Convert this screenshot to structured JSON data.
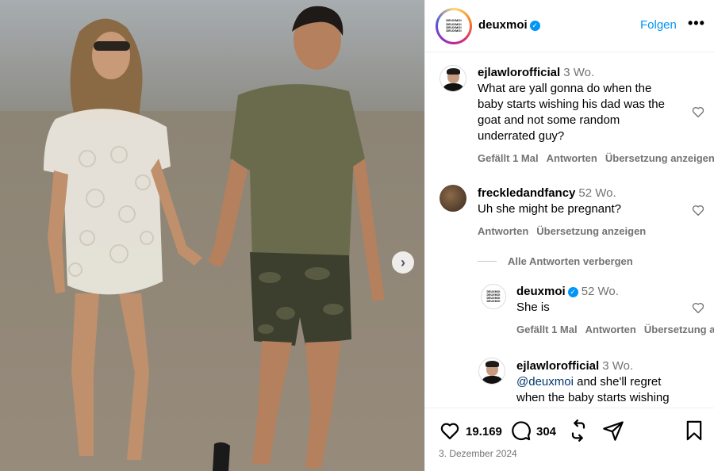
{
  "post": {
    "author": "deuxmoi",
    "avatar_text": [
      "DEUXMOI",
      "DEUXMOI",
      "DEUXMOI",
      "DEUXMOI"
    ],
    "follow_label": "Folgen",
    "more_label": "•••"
  },
  "comments": [
    {
      "user": "ejlawlorofficial",
      "time": "3 Wo.",
      "lines": [
        "What are yall gonna do when the",
        "baby starts wishing his dad was the",
        "goat and not some random",
        "underrated guy?"
      ],
      "likes": "Gefällt 1 Mal",
      "reply": "Antworten",
      "translate": "Übersetzung anzeigen"
    },
    {
      "user": "freckledandfancy",
      "time": "52 Wo.",
      "lines": [
        "Uh she might be pregnant?"
      ],
      "reply": "Antworten",
      "translate": "Übersetzung anzeigen",
      "hide_replies": "Alle Antworten verbergen"
    }
  ],
  "replies": [
    {
      "user": "deuxmoi",
      "time": "52 Wo.",
      "lines": [
        "She is"
      ],
      "likes": "Gefällt 1 Mal",
      "reply": "Antworten",
      "translate": "Übersetzung a"
    },
    {
      "user": "ejlawlorofficial",
      "time": "3 Wo.",
      "mention": "@deuxmoi",
      "line1_rest": " and she'll regret",
      "line2": "when the baby starts wishing"
    }
  ],
  "footer": {
    "like_count": "19.169",
    "comment_count": "304",
    "date": "3. Dezember 2024"
  },
  "colors": {
    "accent": "#0095f6",
    "muted": "#737373",
    "border": "#efefef"
  },
  "icons": [
    "verified-icon",
    "heart-icon",
    "comment-icon",
    "repost-icon",
    "share-icon",
    "bookmark-icon",
    "chevron-right-icon",
    "more-icon"
  ]
}
